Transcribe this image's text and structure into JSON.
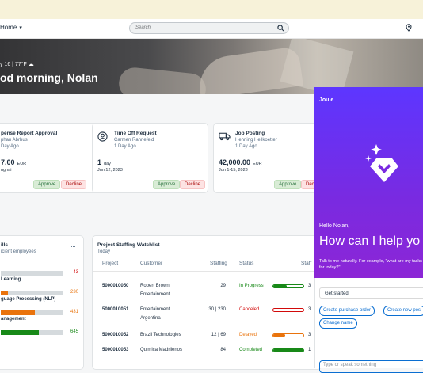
{
  "shell": {
    "home_label": "Home",
    "search_placeholder": "Search"
  },
  "hero": {
    "date_weather": "y 16 | 77°F",
    "greeting": "od morning, Nolan"
  },
  "cards": [
    {
      "title": "pense Report Approval",
      "person": "phan Abrhus",
      "age": "Day Ago",
      "amount": "7.00",
      "currency": "EUR",
      "detail": "nghai",
      "approve": "Approve",
      "decline": "Decline"
    },
    {
      "title": "Time Off Request",
      "person": "Carmen Rannefeld",
      "age": "1 Day Ago",
      "amount": "1",
      "currency": "day",
      "detail": "Jun 12, 2023",
      "approve": "Approve",
      "decline": "Decline"
    },
    {
      "title": "Job Posting",
      "person": "Henning Heilkoetter",
      "age": "1 Day Ago",
      "amount": "42,000.00",
      "currency": "EUR",
      "detail": "Jun 1-15, 2023",
      "approve": "Approve",
      "decline": "Decl"
    }
  ],
  "skills": {
    "title": "ills",
    "subtitle": "icient employees",
    "items": [
      {
        "label": "",
        "value": "43",
        "fraction": 0.0,
        "color": "#e9730c",
        "value_color": "#d20a0a"
      },
      {
        "label": "Learning",
        "value": "230",
        "fraction": 0.12,
        "color": "#e9730c",
        "value_color": "#e9730c"
      },
      {
        "label": "guage Processing (NLP)",
        "value": "431",
        "fraction": 0.55,
        "color": "#e9730c",
        "value_color": "#e9730c"
      },
      {
        "label": "anagement",
        "value": "645",
        "fraction": 0.62,
        "color": "#188918",
        "value_color": "#188918"
      }
    ]
  },
  "watchlist": {
    "title": "Project Staffing Watchlist",
    "subtitle": "Today",
    "columns": [
      "Project",
      "Customer",
      "Staffing",
      "Status",
      "Staff"
    ],
    "rows": [
      {
        "project": "5000010050",
        "customer": [
          "Robert Brown",
          "Entertainment"
        ],
        "staffing": "29",
        "status": "In Progress",
        "status_color": "#188918",
        "fill": 0.45,
        "bar_color": "#188918"
      },
      {
        "project": "5000010051",
        "customer": [
          "Entertainment",
          "Argentina"
        ],
        "staffing": "30 | 230",
        "status": "Canceled",
        "status_color": "#d20a0a",
        "fill": 0.0,
        "bar_color": "#d20a0a"
      },
      {
        "project": "5000010052",
        "customer": [
          "Brazil Technologies"
        ],
        "staffing": "12 | 69",
        "status": "Delayed",
        "status_color": "#e9730c",
        "fill": 0.4,
        "bar_color": "#e9730c"
      },
      {
        "project": "5000010053",
        "customer": [
          "Quimica Madrilenos"
        ],
        "staffing": "84",
        "status": "Completed",
        "status_color": "#188918",
        "fill": 1.0,
        "bar_color": "#188918"
      }
    ],
    "extra": [
      "3",
      "3",
      "3",
      "1"
    ]
  },
  "joule": {
    "title": "Joule",
    "hello": "Hello Nolan,",
    "headline": "How can I help yo",
    "hint": "Talk to me naturally. For example, \"what are my tasks for today?\"",
    "get_started": "Get started",
    "chips": [
      "Create purchase order",
      "Create new posi",
      "Change name"
    ],
    "input_placeholder": "Type or speak something"
  },
  "colors": {
    "accent": "#0a6ed1",
    "joule_gradient_top": "#5d36ff",
    "joule_gradient_bottom": "#8c26d6"
  }
}
